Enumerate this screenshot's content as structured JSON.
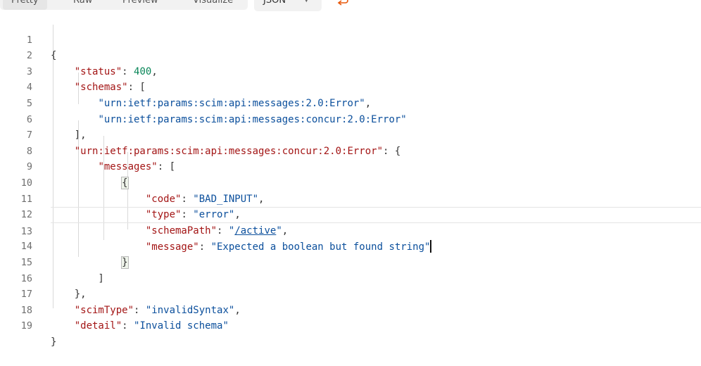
{
  "tabs": [
    {
      "label": "Pretty"
    },
    {
      "label": "Raw"
    },
    {
      "label": "Preview"
    },
    {
      "label": "Visualize"
    }
  ],
  "format_select": {
    "value": "JSON"
  },
  "editor": {
    "line_numbers": [
      "1",
      "2",
      "3",
      "4",
      "5",
      "6",
      "7",
      "8",
      "9",
      "10",
      "11",
      "12",
      "13",
      "14",
      "15",
      "16",
      "17",
      "18",
      "19"
    ],
    "content": {
      "status_key": "\"status\"",
      "status_value": "400",
      "schemas_key": "\"schemas\"",
      "schema_1": "\"urn:ietf:params:scim:api:messages:2.0:Error\"",
      "schema_2": "\"urn:ietf:params:scim:api:messages:concur:2.0:Error\"",
      "ext_key": "\"urn:ietf:params:scim:api:messages:concur:2.0:Error\"",
      "messages_key": "\"messages\"",
      "code_key": "\"code\"",
      "code_value": "\"BAD_INPUT\"",
      "type_key": "\"type\"",
      "type_value": "\"error\"",
      "schemaPath_key": "\"schemaPath\"",
      "schemaPath_q1": "\"",
      "schemaPath_link": "/active",
      "schemaPath_q2": "\"",
      "message_key": "\"message\"",
      "message_value": "\"Expected a boolean but found string\"",
      "scimType_key": "\"scimType\"",
      "scimType_value": "\"invalidSyntax\"",
      "detail_key": "\"detail\"",
      "detail_value": "\"Invalid schema\""
    }
  }
}
